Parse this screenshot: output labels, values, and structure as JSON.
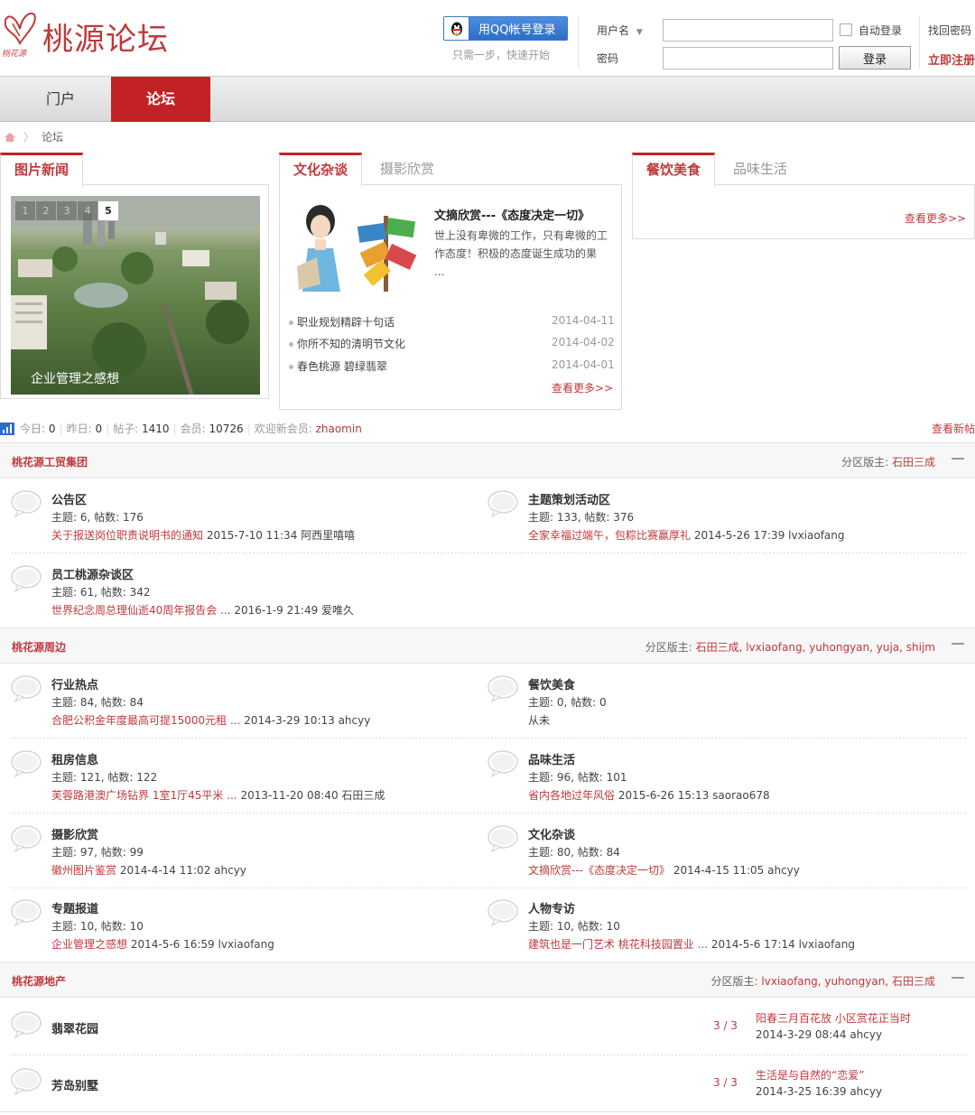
{
  "header": {
    "logo_text": "桃源论坛",
    "logo_small": "桃花源",
    "qq_login": "用QQ帐号登录",
    "qq_tip": "只需一步，快速开始",
    "username_label": "用户名",
    "password_label": "密码",
    "auto_login": "自动登录",
    "login_button": "登录",
    "find_password": "找回密码",
    "register": "立即注册"
  },
  "nav": {
    "portal": "门户",
    "forum": "论坛"
  },
  "breadcrumb": {
    "current": "论坛"
  },
  "panel1": {
    "tab": "图片新闻",
    "slide_caption": "企业管理之感想",
    "slide_numbers": [
      "1",
      "2",
      "3",
      "4",
      "5"
    ]
  },
  "panel2": {
    "tabs": [
      "文化杂谈",
      "摄影欣赏"
    ],
    "article_title": "文摘欣赏---《态度决定一切》",
    "article_summary": "世上没有卑微的工作，只有卑微的工作态度！积极的态度诞生成功的果 ...",
    "items": [
      {
        "title": "职业规划精辟十句话",
        "date": "2014-04-11"
      },
      {
        "title": "你所不知的清明节文化",
        "date": "2014-04-02"
      },
      {
        "title": "春色桃源 碧绿翡翠",
        "date": "2014-04-01"
      }
    ],
    "more": "查看更多>>"
  },
  "panel3": {
    "tabs": [
      "餐饮美食",
      "品味生活"
    ],
    "more": "查看更多>>"
  },
  "stats": {
    "today_label": "今日:",
    "today": "0",
    "yesterday_label": "昨日:",
    "yesterday": "0",
    "posts_label": "帖子:",
    "posts": "1410",
    "members_label": "会员:",
    "members": "10726",
    "welcome_label": "欢迎新会员:",
    "newest": "zhaomin",
    "view_new": "查看新帖"
  },
  "categories": [
    {
      "name": "桃花源工贸集团",
      "moderator_label": "分区版主:",
      "moderators": "石田三成",
      "forums": [
        {
          "name": "公告区",
          "stats": "主题: 6, 帖数: 176",
          "last_link": "关于报送岗位职责说明书的通知",
          "last_info": " 2015-7-10 11:34 阿西里嘻嘻"
        },
        {
          "name": "主题策划活动区",
          "stats": "主题: 133, 帖数: 376",
          "last_link": "全家幸福过端午，包粽比赛赢厚礼",
          "last_info": " 2014-5-26 17:39 lvxiaofang"
        },
        {
          "name": "员工桃源杂谈区",
          "stats": "主题: 61, 帖数: 342",
          "last_link": "世界纪念周总理仙逝40周年报告会 ...",
          "last_info": " 2016-1-9 21:49 爱唯久"
        }
      ]
    },
    {
      "name": "桃花源周边",
      "moderator_label": "分区版主:",
      "moderators": "石田三成, lvxiaofang, yuhongyan, yuja, shijm",
      "forums": [
        {
          "name": "行业热点",
          "stats": "主题: 84, 帖数: 84",
          "last_link": "合肥公积金年度最高可提15000元租 ...",
          "last_info": " 2014-3-29 10:13 ahcyy"
        },
        {
          "name": "餐饮美食",
          "stats": "主题: 0, 帖数: 0",
          "last_link": "",
          "last_info": "从未"
        },
        {
          "name": "租房信息",
          "stats": "主题: 121, 帖数: 122",
          "last_link": "芙蓉路港澳广场钻界 1室1厅45平米 ...",
          "last_info": " 2013-11-20 08:40 石田三成"
        },
        {
          "name": "品味生活",
          "stats": "主题: 96, 帖数: 101",
          "last_link": "省内各地过年风俗",
          "last_info": " 2015-6-26 15:13 saorao678"
        },
        {
          "name": "摄影欣赏",
          "stats": "主题: 97, 帖数: 99",
          "last_link": "徽州图片鉴赏",
          "last_info": " 2014-4-14 11:02 ahcyy"
        },
        {
          "name": "文化杂谈",
          "stats": "主题: 80, 帖数: 84",
          "last_link": "文摘欣赏---《态度决定一切》",
          "last_info": " 2014-4-15 11:05 ahcyy"
        },
        {
          "name": "专题报道",
          "stats": "主题: 10, 帖数: 10",
          "last_link": "企业管理之感想",
          "last_info": " 2014-5-6 16:59 lvxiaofang"
        },
        {
          "name": "人物专访",
          "stats": "主题: 10, 帖数: 10",
          "last_link": "建筑也是一门艺术 桃花科技园置业 ...",
          "last_info": " 2014-5-6 17:14 lvxiaofang"
        }
      ]
    },
    {
      "name": "桃花源地产",
      "moderator_label": "分区版主:",
      "moderators": "lvxiaofang, yuhongyan, 石田三成",
      "forums": [
        {
          "name": "翡翠花园",
          "count": "3 / 3",
          "last_link": "阳春三月百花放 小区赏花正当时",
          "last_info": "2014-3-29 08:44 ahcyy"
        },
        {
          "name": "芳岛别墅",
          "count": "3 / 3",
          "last_link": "生活是与自然的“恋爱”",
          "last_info": "2014-3-25 16:39 ahcyy"
        }
      ]
    }
  ],
  "colors": {
    "accent": "#c22125",
    "link": "#c0393b",
    "qq": "#2d6fc4"
  }
}
